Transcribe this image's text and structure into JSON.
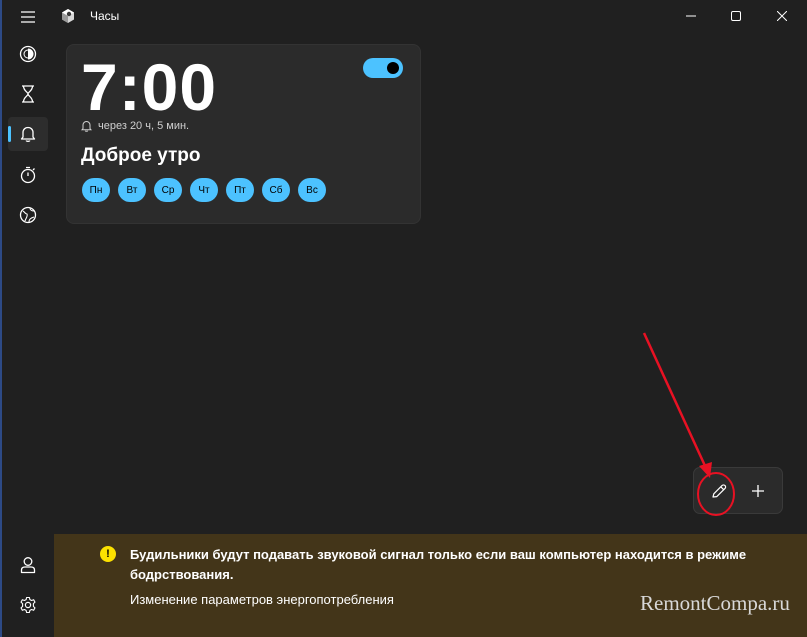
{
  "window": {
    "title": "Часы",
    "controls": [
      "minimize-icon",
      "maximize-icon",
      "close-icon"
    ]
  },
  "nav": {
    "items": [
      {
        "icon": "focus-session-icon"
      },
      {
        "icon": "timer-hourglass-icon"
      },
      {
        "icon": "alarm-bell-icon",
        "active": true
      },
      {
        "icon": "stopwatch-icon"
      },
      {
        "icon": "world-clock-icon"
      }
    ],
    "bottom": [
      {
        "icon": "account-icon"
      },
      {
        "icon": "settings-gear-icon"
      }
    ]
  },
  "alarm": {
    "time": "7:00",
    "enabled": true,
    "remaining": "через 20 ч, 5 мин.",
    "name": "Доброе утро",
    "days": [
      "Пн",
      "Вт",
      "Ср",
      "Чт",
      "Пт",
      "Сб",
      "Вс"
    ]
  },
  "actions": {
    "edit_icon": "pencil-icon",
    "add_icon": "plus-icon"
  },
  "infobar": {
    "message": "Будильники будут подавать звуковой сигнал только если ваш компьютер находится в режиме бодрствования.",
    "link": "Изменение параметров энергопотребления",
    "watermark": "RemontCompa.ru"
  },
  "colors": {
    "accent": "#4cc2ff",
    "background": "#202020",
    "card": "#2b2b2b",
    "infobar": "#433519",
    "warning": "#fce100",
    "annotation": "#e81123"
  }
}
